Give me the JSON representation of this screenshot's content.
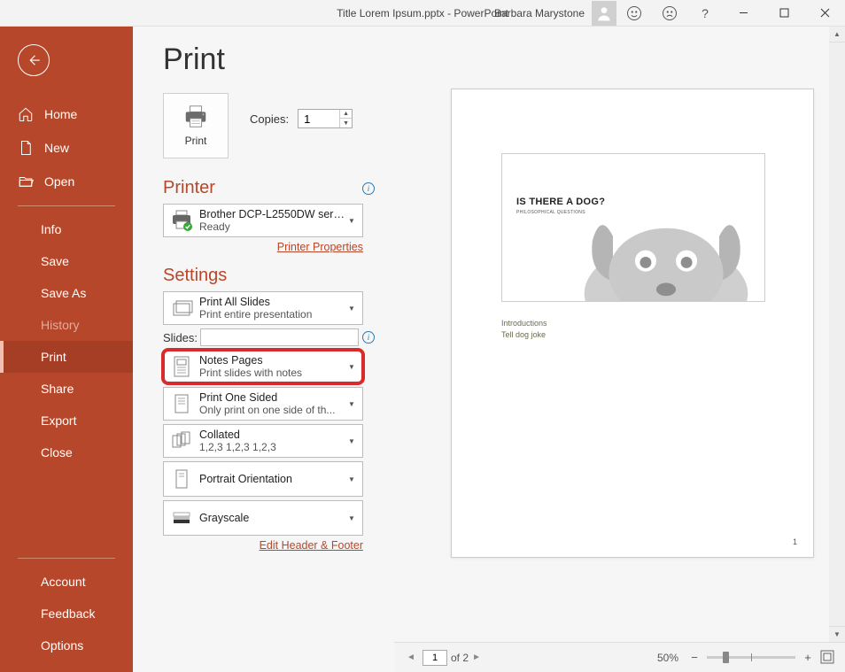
{
  "titlebar": {
    "doc_title": "Title Lorem Ipsum.pptx  -  PowerPoint",
    "user_name": "Barbara Marystone"
  },
  "sidebar": {
    "home": "Home",
    "new": "New",
    "open": "Open",
    "info": "Info",
    "save": "Save",
    "save_as": "Save As",
    "history": "History",
    "print": "Print",
    "share": "Share",
    "export": "Export",
    "close": "Close",
    "account": "Account",
    "feedback": "Feedback",
    "options": "Options"
  },
  "print": {
    "page_title": "Print",
    "button_label": "Print",
    "copies_label": "Copies:",
    "copies_value": "1",
    "printer_header": "Printer",
    "printer_name": "Brother DCP-L2550DW serie...",
    "printer_status": "Ready",
    "printer_props_link": "Printer Properties",
    "settings_header": "Settings",
    "slides_label": "Slides:",
    "edit_header_link": "Edit Header & Footer",
    "dd_all": {
      "title": "Print All Slides",
      "sub": "Print entire presentation"
    },
    "dd_notes": {
      "title": "Notes Pages",
      "sub": "Print slides with notes"
    },
    "dd_oneside": {
      "title": "Print One Sided",
      "sub": "Only print on one side of th..."
    },
    "dd_collated": {
      "title": "Collated",
      "sub": "1,2,3    1,2,3    1,2,3"
    },
    "dd_orient": {
      "title": "Portrait Orientation"
    },
    "dd_color": {
      "title": "Grayscale"
    }
  },
  "preview": {
    "slide_title": "IS THERE A DOG?",
    "slide_sub": "PHILOSOPHICAL QUESTIONS",
    "note1": "Introductions",
    "note2": "Tell dog joke",
    "page_number": "1",
    "nav_current": "1",
    "nav_total": "of 2",
    "zoom_pct": "50%"
  }
}
